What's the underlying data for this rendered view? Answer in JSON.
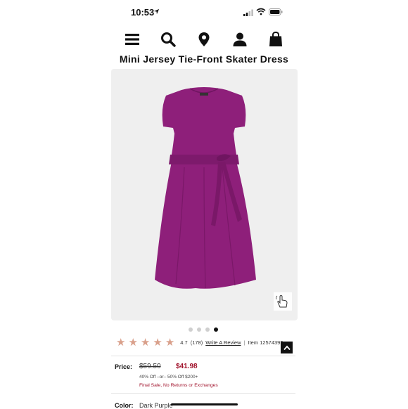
{
  "status_bar": {
    "time": "10:53"
  },
  "nav": {
    "icons": [
      "menu-icon",
      "search-icon",
      "location-pin-icon",
      "account-icon",
      "shopping-bag-icon"
    ]
  },
  "product": {
    "title": "Mini Jersey Tie-Front Skater Dress",
    "rating": "4.7",
    "review_count": "(178)",
    "write_review": "Write A Review",
    "separator": "|",
    "item_number": "Item 12574395",
    "stars_filled": 4.7
  },
  "gallery": {
    "image_count": 4,
    "active_index": 3
  },
  "price": {
    "label": "Price:",
    "original": "$59.50",
    "sale": "$41.98",
    "promo": "40% Off –or– 50% Off $200+",
    "final_sale": "Final Sale, No Returns or Exchanges"
  },
  "color": {
    "label": "Color:",
    "value": "Dark Purple"
  },
  "colors": {
    "dress": "#8e1f7a",
    "sale_price": "#a1132c",
    "star": "#d9a08b"
  }
}
